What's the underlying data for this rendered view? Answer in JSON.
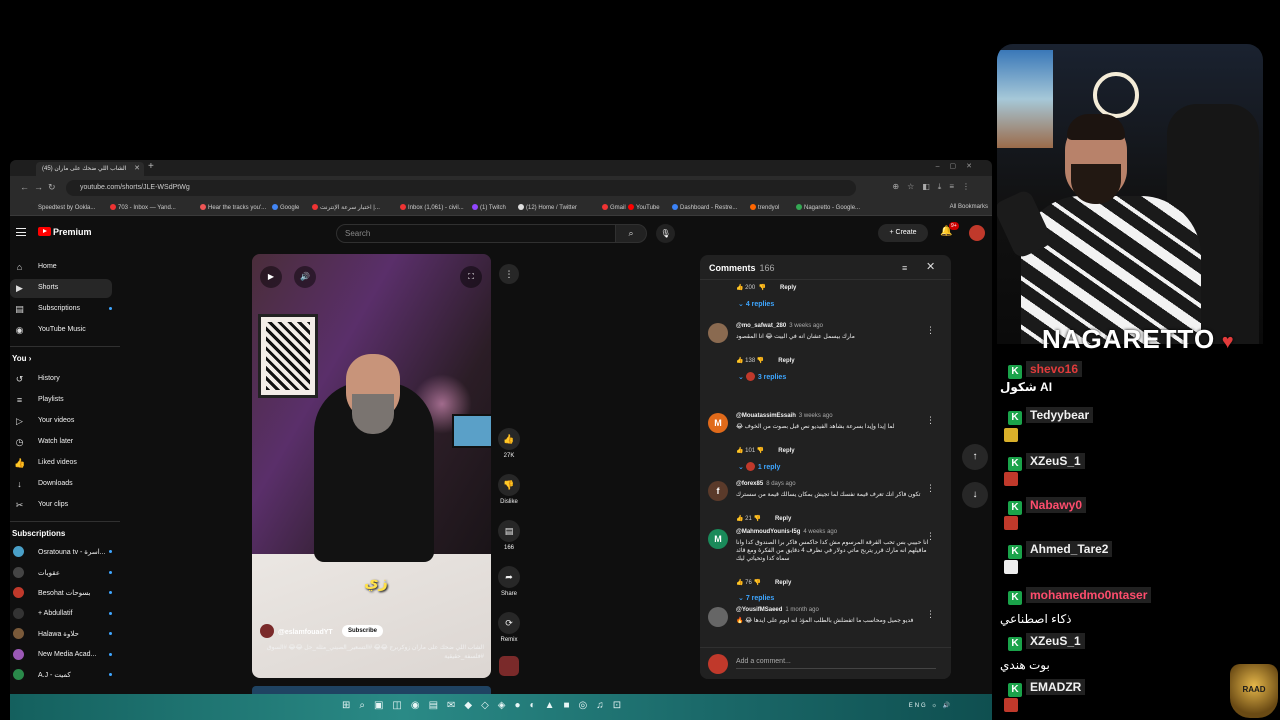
{
  "browser": {
    "tab_title": "(45) الشاب اللي ضحك على ماران",
    "url": "youtube.com/shorts/JLE-WSdPtWg",
    "bookmarks": [
      {
        "label": "Speedtest by Ookla...",
        "color": "#2a2a2a"
      },
      {
        "label": "703 - Inbox — Yand...",
        "color": "#e33"
      },
      {
        "label": "Hear the tracks you'...",
        "color": "#e55"
      },
      {
        "label": "Google",
        "color": "#4285f4"
      },
      {
        "label": "اختبار سرعة الإنترنت |...",
        "color": "#e33"
      },
      {
        "label": "Inbox (1,061) - civil...",
        "color": "#e33"
      },
      {
        "label": "(1) Twitch",
        "color": "#9146ff"
      },
      {
        "label": "(12) Home / Twitter",
        "color": "#ddd"
      },
      {
        "label": "Gmail",
        "color": "#e33"
      },
      {
        "label": "YouTube",
        "color": "#f00"
      },
      {
        "label": "Dashboard - Restre...",
        "color": "#3b82f6"
      },
      {
        "label": "trendyol",
        "color": "#f60"
      },
      {
        "label": "Nagaretto - Google...",
        "color": "#34a853"
      }
    ],
    "all_bookmarks": "All Bookmarks"
  },
  "yt": {
    "logo": "Premium",
    "search_placeholder": "Search",
    "create": "Create",
    "notif_badge": "9+"
  },
  "sidebar": {
    "main": [
      {
        "label": "Home",
        "icon": "⌂"
      },
      {
        "label": "Shorts",
        "icon": "▶"
      },
      {
        "label": "Subscriptions",
        "icon": "▤"
      },
      {
        "label": "YouTube Music",
        "icon": "◉"
      }
    ],
    "you_heading": "You",
    "you": [
      {
        "label": "History",
        "icon": "↺"
      },
      {
        "label": "Playlists",
        "icon": "≡"
      },
      {
        "label": "Your videos",
        "icon": "▷"
      },
      {
        "label": "Watch later",
        "icon": "◷"
      },
      {
        "label": "Liked videos",
        "icon": "👍"
      },
      {
        "label": "Downloads",
        "icon": "↓"
      },
      {
        "label": "Your clips",
        "icon": "✂"
      }
    ],
    "subs_heading": "Subscriptions",
    "subs": [
      {
        "label": "Osratouna tv - اسرة...",
        "color": "#4aa0c8"
      },
      {
        "label": "عقوبات",
        "color": "#444"
      },
      {
        "label": "Besohat بسوحات",
        "color": "#c0392b"
      },
      {
        "label": "+ Abdullatif",
        "color": "#333"
      },
      {
        "label": "Halawa حلاوة",
        "color": "#7a5a3a"
      },
      {
        "label": "New Media Acad...",
        "color": "#9b59b6"
      },
      {
        "label": "A.J - كميت",
        "color": "#2a8a4a"
      }
    ]
  },
  "video": {
    "caption": "زي",
    "channel": "@eslamfouadYT",
    "subscribe": "Subscribe",
    "title": "الشاب اللي ضحك على ماران زوكربرج 😂😂 #التسعير_الصيني_مثله_حل 😂😂 #السوق #فلسفة_حقيقية"
  },
  "actions": {
    "likes": "27K",
    "dislike": "Dislike",
    "comments": "166",
    "share": "Share",
    "remix": "Remix"
  },
  "comments": {
    "title": "Comments",
    "count": "166",
    "add_placeholder": "Add a comment...",
    "top_likes": "200",
    "top_reply": "Reply",
    "top_replies": "4 replies",
    "items": [
      {
        "author": "@mo_safwat_280",
        "time": "3 weeks ago",
        "text": "مارك بيسمل عشان انه في البيت 😂 انا المقصود",
        "likes": "138",
        "reply": "Reply",
        "replies": "3 replies",
        "avatar_letter": "",
        "avatar_color": "#8a6a50"
      },
      {
        "author": "@MouatassimEssaih",
        "time": "3 weeks ago",
        "text": "لما إيدا وإيدا بسرعة بشاهد الفيديو نص قبل بصوت من الخوف 😂",
        "likes": "101",
        "reply": "Reply",
        "replies": "1 reply",
        "avatar_letter": "M",
        "avatar_color": "#e06a1a"
      },
      {
        "author": "@forex85",
        "time": "8 days ago",
        "text": "تكون فاكر انك تعرف قيمة نفسك لما تجيش بمكان يسالك قيمة من سسترك",
        "likes": "21",
        "reply": "Reply",
        "replies": "",
        "avatar_letter": "f",
        "avatar_color": "#5a3a2a"
      },
      {
        "author": "@MahmoudYounis-I5g",
        "time": "4 weeks ago",
        "text": "انا حبيبي بس تحب الفرقة المرسوم مش كدا حاكمس فاكر برا الصندوق كدا وانا ماقيلهم انه مارك قرر يتربح ماتي دولار في نظرف 4 دقايق من الفكرة ومع قائد سماه كدا وتحياتي ليك",
        "likes": "76",
        "reply": "Reply",
        "replies": "7 replies",
        "avatar_letter": "M",
        "avatar_color": "#1a8a5a"
      },
      {
        "author": "@YousifMSaeed",
        "time": "1 month ago",
        "text": "فديو جميل ومحاسب ما اتفضلش بالطلب المؤذ انه ايوم على ايدها 😂 🔥",
        "likes": "",
        "reply": "",
        "replies": "",
        "avatar_letter": "",
        "avatar_color": "#666"
      }
    ]
  },
  "stream": {
    "brand": "NAGARETTO",
    "chat": [
      {
        "user": "shevo16",
        "color": "#e23b3b",
        "msg": ""
      },
      {
        "user": "",
        "color": "",
        "msg": "شكول AI"
      },
      {
        "user": "Tedyybear",
        "color": "#f1f1f1",
        "msg": ""
      },
      {
        "user": "XZeuS_1",
        "color": "#f1f1f1",
        "msg": ""
      },
      {
        "user": "Nabawy0",
        "color": "#ff4d6d",
        "msg": ""
      },
      {
        "user": "Ahmed_Tare2",
        "color": "#f1f1f1",
        "msg": ""
      },
      {
        "user": "mohamedmo0ntaser",
        "color": "#ff4d6d",
        "msg": "ذكاء اصطناعي"
      },
      {
        "user": "XZeuS_1",
        "color": "#f1f1f1",
        "msg": "بوت هندي"
      },
      {
        "user": "EMADZR",
        "color": "#f1f1f1",
        "msg": ""
      }
    ],
    "badge": "RAAD"
  }
}
